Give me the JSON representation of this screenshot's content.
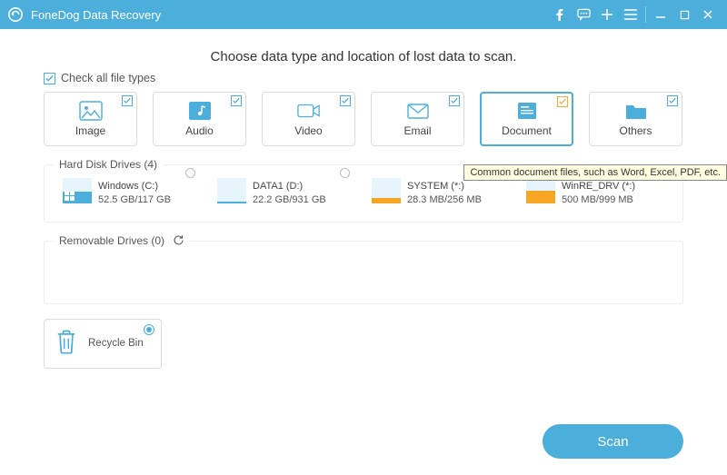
{
  "app": {
    "title": "FoneDog Data Recovery"
  },
  "headline": "Choose data type and location of lost data to scan.",
  "check_all_label": "Check all file types",
  "types": {
    "image": "Image",
    "audio": "Audio",
    "video": "Video",
    "email": "Email",
    "document": "Document",
    "others": "Others"
  },
  "tooltip": "Common document files, such as Word, Excel, PDF, etc.",
  "sections": {
    "hdd_title": "Hard Disk Drives (4)",
    "removable_title": "Removable Drives (0)"
  },
  "drives": [
    {
      "name": "Windows (C:)",
      "size": "52.5 GB/117 GB",
      "fill_pct": 45,
      "color": "#4baedb",
      "os": true
    },
    {
      "name": "DATA1 (D:)",
      "size": "22.2 GB/931 GB",
      "fill_pct": 8,
      "color": "#4baedb",
      "os": false
    },
    {
      "name": "SYSTEM (*:)",
      "size": "28.3 MB/256 MB",
      "fill_pct": 22,
      "color": "#f6a623",
      "os": false
    },
    {
      "name": "WinRE_DRV (*:)",
      "size": "500 MB/999 MB",
      "fill_pct": 50,
      "color": "#f6a623",
      "os": false
    }
  ],
  "bin": {
    "label": "Recycle Bin"
  },
  "scan_label": "Scan",
  "colors": {
    "accent": "#4baedb",
    "orange": "#f6a623"
  }
}
